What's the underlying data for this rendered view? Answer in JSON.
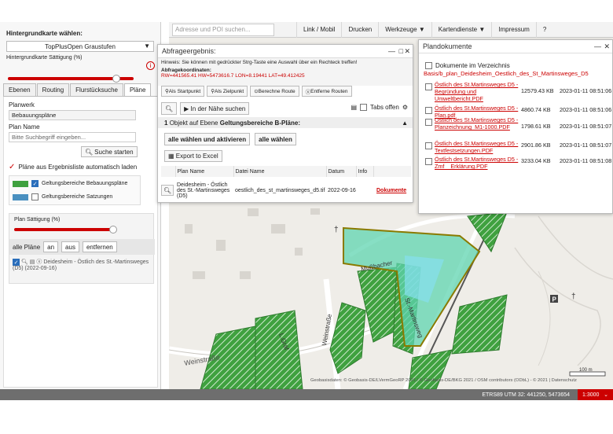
{
  "toolbar": {
    "search_placeholder": "Adresse und POI suchen...",
    "items": [
      "Link / Mobil",
      "Drucken",
      "Werkzeuge",
      "Kartendienste",
      "Impressum",
      "?"
    ]
  },
  "left": {
    "bg_title": "Hintergrundkarte wählen:",
    "bg_select": "TopPlusOpen Graustufen",
    "bg_saturation_label": "Hintergrundkarte Sättigung (%)",
    "bg_saturation": 0.86,
    "tabs": [
      "Ebenen",
      "Routing",
      "Flurstücksuche",
      "Pläne"
    ],
    "active_tab": "Pläne",
    "planwerk_label": "Planwerk",
    "planwerk_value": "Bebauungspläne",
    "planname_label": "Plan Name",
    "planname_placeholder": "Bitte Suchbegriff eingeben...",
    "search_button": "Suche starten",
    "auto_load_label": "Pläne aus Ergebnisliste automatisch laden",
    "legend": [
      {
        "label": "Geltungsbereiche Bebauungspläne",
        "checked": true
      },
      {
        "label": "Geltungsbereiche Satzungen",
        "checked": false
      }
    ],
    "plan_saturation_label": "Plan Sättigung (%)",
    "plan_saturation": 0.97,
    "all_plans_label": "alle Pläne",
    "on_button": "an",
    "off_button": "aus",
    "remove_button": "entfernen",
    "plan_entry": "Deidesheim - Östlich des St.-Martinsweges (D5) (2022-09-16)"
  },
  "abfrage": {
    "title": "Abfrageergebnis:",
    "hint": "Hinweis: Sie können mit gedrückter Strg-Taste eine Auswahl über ein Rechteck treffen!",
    "coord_title": "Abfragekoordinaten:",
    "coords": "RW=441565.41  HW=5473616.7  LON=8.19441  LAT=49.412425",
    "buttons": [
      "Als Startpunkt",
      "Als Zielpunkt",
      "Berechne Route",
      "Entferne Routen"
    ],
    "nearby_button": "In der Nähe suchen",
    "tabs_offen": "Tabs offen",
    "objects_count": "1",
    "objects_text": "Objekt auf Ebene",
    "objects_layer": "Geltungsbereiche B-Pläne:",
    "select_activate": "alle wählen und aktivieren",
    "select_all": "alle wählen",
    "export": "Export to Excel",
    "columns": [
      "Plan Name",
      "Datei Name",
      "Datum",
      "Info",
      ""
    ],
    "row": {
      "plan_name": "Deidesheim - Östlich des St.-Martinsweges (D5)",
      "file_name": "oestlich_des_st_martinsweges_d5.tif",
      "date": "2022-09-16",
      "info": "",
      "link": "Dokumente"
    }
  },
  "plandok": {
    "title": "Plandokumente",
    "dir_label": "Dokumente im Verzeichnis",
    "path": "Basis/b_plan_Deidesheim_Oestlich_des_St_Martinsweges_D5",
    "files": [
      {
        "name": "Östlich des St.Martinsweges D5 - Begründung und Umweltbericht.PDF",
        "size": "12579.43 KB",
        "date": "2023-01-11 08:51:06"
      },
      {
        "name": "Östlich des St.Martinsweges D5 - Plan.pdf",
        "size": "4860.74 KB",
        "date": "2023-01-11 08:51:06"
      },
      {
        "name": "Östlich des St.Martinsweges D5 - Planzeichnung_M1-1000.PDF",
        "size": "1798.61 KB",
        "date": "2023-01-11 08:51:07"
      },
      {
        "name": "Östlich des St.Martinsweges D5 - Textfestsetzungen.PDF",
        "size": "2901.86 KB",
        "date": "2023-01-11 08:51:07"
      },
      {
        "name": "Östlich des St.Martinsweges D5 - Zmf__Erklärung.PDF",
        "size": "3233.04 KB",
        "date": "2023-01-11 08:51:08"
      }
    ]
  },
  "map": {
    "streets": [
      "Weinstraße",
      "St.-Martinsweg",
      "Mußbacher",
      "Weinstraße",
      "L.Gräf"
    ],
    "scale_label": "100 m",
    "attribution": "Geobasisdaten: © Geobasis-DE/LVermGeoRP 2021 / © Geobasis-DE/BKG 2021 / OSM contributors (ODbL) - © 2021 | Datenschutz",
    "coords_bar": "ETRS89 UTM 32: 441250, 5473654",
    "scale_select": "1:3000"
  }
}
